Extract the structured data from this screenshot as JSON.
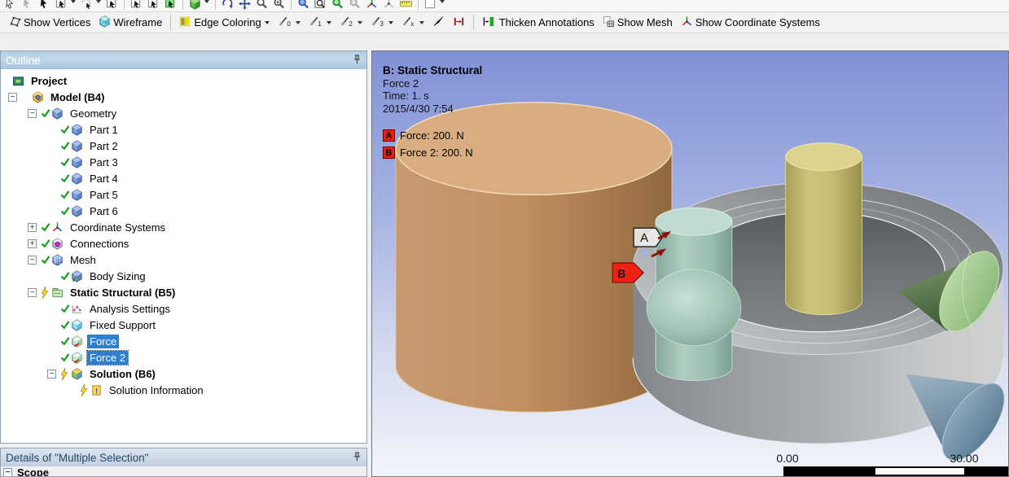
{
  "toolbar_main": {
    "items": [
      {
        "icon": "cursor-outline"
      },
      {
        "icon": "cursor-gray"
      },
      {
        "icon": "cursor"
      },
      {
        "icon": "box-select",
        "caret": true
      },
      {
        "icon": "lasso-select",
        "caret": true
      },
      {
        "icon": "box-select"
      },
      {
        "sep": true
      },
      {
        "icon": "box-select"
      },
      {
        "icon": "box-select"
      },
      {
        "icon": "box-select-green"
      },
      {
        "sep": true
      },
      {
        "icon": "cube-select-green",
        "caret": true
      },
      {
        "sep": true
      },
      {
        "icon": "rotate"
      },
      {
        "icon": "pan"
      },
      {
        "icon": "zoom-out"
      },
      {
        "icon": "zoom-in"
      },
      {
        "sep": true
      },
      {
        "icon": "zoom-box-blue"
      },
      {
        "icon": "zoom-window"
      },
      {
        "icon": "zoom-fit-green"
      },
      {
        "icon": "zoom-gray"
      },
      {
        "icon": "triad"
      },
      {
        "icon": "triad-gray"
      },
      {
        "icon": "ruler"
      },
      {
        "sep": true
      },
      {
        "icon": "color-swatch",
        "caret": true
      }
    ]
  },
  "toolbar_graphics": {
    "items": [
      {
        "icon": "show-vertices",
        "label": "Show Vertices"
      },
      {
        "icon": "wireframe",
        "label": "Wireframe"
      },
      {
        "sep": true
      },
      {
        "icon": "edge-coloring",
        "label": "Edge Coloring",
        "caret": true
      },
      {
        "icon": "edge",
        "sub": "0",
        "caret": true
      },
      {
        "icon": "edge",
        "sub": "1",
        "caret": true
      },
      {
        "icon": "edge",
        "sub": "2",
        "caret": true
      },
      {
        "icon": "edge",
        "sub": "3",
        "caret": true
      },
      {
        "icon": "edge",
        "sub": "x",
        "caret": true
      },
      {
        "icon": "dart"
      },
      {
        "icon": "expand-bars"
      },
      {
        "sep": true
      },
      {
        "icon": "thicken",
        "label": "Thicken Annotations"
      },
      {
        "icon": "show-mesh",
        "label": "Show Mesh"
      },
      {
        "icon": "show-csys",
        "label": "Show Coordinate Systems"
      }
    ]
  },
  "outline": {
    "title": "Outline",
    "tree": [
      {
        "label": "Project",
        "level": 0,
        "icon": "project",
        "bold": true
      },
      {
        "label": "Model (B4)",
        "level": 1,
        "icon": "model",
        "expand": "minus",
        "bold": true
      },
      {
        "label": "Geometry",
        "level": 2,
        "icon": "geometry",
        "expand": "minus",
        "check": true
      },
      {
        "label": "Part 1",
        "level": 3,
        "icon": "part",
        "check": true
      },
      {
        "label": "Part 2",
        "level": 3,
        "icon": "part",
        "check": true
      },
      {
        "label": "Part 3",
        "level": 3,
        "icon": "part",
        "check": true
      },
      {
        "label": "Part 4",
        "level": 3,
        "icon": "part",
        "check": true
      },
      {
        "label": "Part 5",
        "level": 3,
        "icon": "part",
        "check": true
      },
      {
        "label": "Part 6",
        "level": 3,
        "icon": "part",
        "check": true
      },
      {
        "label": "Coordinate Systems",
        "level": 2,
        "icon": "csys",
        "expand": "plus",
        "check": true
      },
      {
        "label": "Connections",
        "level": 2,
        "icon": "connections",
        "expand": "plus",
        "check": true
      },
      {
        "label": "Mesh",
        "level": 2,
        "icon": "mesh",
        "expand": "minus",
        "check": true
      },
      {
        "label": "Body Sizing",
        "level": 3,
        "icon": "body-sizing",
        "check": true
      },
      {
        "label": "Static Structural (B5)",
        "level": 2,
        "icon": "static",
        "expand": "minus",
        "lightning": true,
        "bold": true
      },
      {
        "label": "Analysis Settings",
        "level": 3,
        "icon": "analysis",
        "check": true
      },
      {
        "label": "Fixed Support",
        "level": 3,
        "icon": "fixed-support",
        "check": true
      },
      {
        "label": "Force",
        "level": 3,
        "icon": "force",
        "check": true,
        "selected": true
      },
      {
        "label": "Force 2",
        "level": 3,
        "icon": "force",
        "check": true,
        "selected": true,
        "focused": true
      },
      {
        "label": "Solution (B6)",
        "level": 3,
        "icon": "solution",
        "expand": "minus",
        "lightning": true,
        "bold": true
      },
      {
        "label": "Solution Information",
        "level": 4,
        "icon": "solution-info",
        "lightning": true
      }
    ]
  },
  "details": {
    "title": "Details of \"Multiple Selection\"",
    "rows": [
      {
        "label": "Scope",
        "expand": "minus"
      }
    ]
  },
  "viewport": {
    "header": {
      "title": "B: Static Structural",
      "lines": [
        "Force 2",
        "Time: 1. s",
        "2015/4/30 7:54"
      ]
    },
    "legend": [
      {
        "tag": "A",
        "text": "Force: 200. N"
      },
      {
        "tag": "B",
        "text": "Force 2: 200. N"
      }
    ],
    "flags": {
      "a": "A",
      "b": "B"
    },
    "ruler": {
      "min": "0.00",
      "max": "30.00"
    },
    "colors": {
      "background_top": "#8191d6",
      "background_bottom": "#f3f5fb",
      "selection_blue": "#2e7fd4",
      "annotation_red": "#ee1c10",
      "arrow_red": "#8a1410",
      "tan_body": "#bd8d61",
      "ring_gray": "#a4a7aa",
      "teal_body": "#9cc0b2",
      "yellow_body": "#c7be74",
      "green_cone": "#5a7a50",
      "steel_cone": "#7b93a8"
    }
  }
}
